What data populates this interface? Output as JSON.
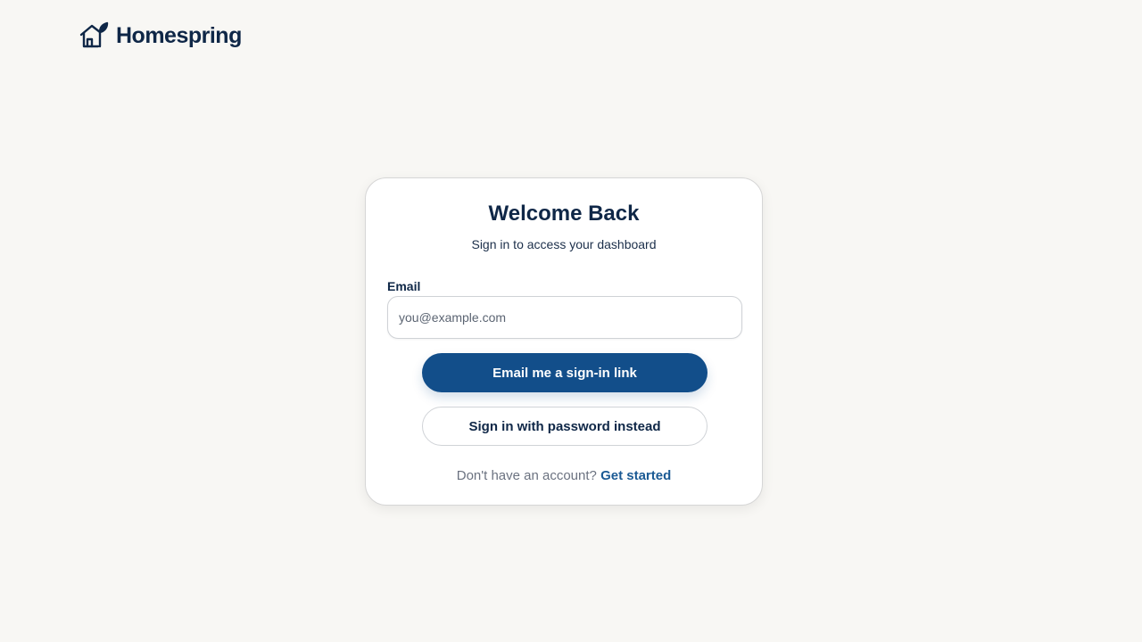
{
  "brand": {
    "name": "Homespring",
    "logo_icon": "house-with-sprout-icon"
  },
  "card": {
    "title": "Welcome Back",
    "subtitle": "Sign in to access your dashboard",
    "email": {
      "label": "Email",
      "placeholder": "you@example.com",
      "value": ""
    },
    "primary_button": "Email me a sign-in link",
    "secondary_button": "Sign in with password instead",
    "footer": {
      "prompt": "Don't have an account?",
      "link": "Get started"
    }
  },
  "colors": {
    "background": "#f8f7f4",
    "primary": "#124e8a",
    "text_dark": "#0f2747",
    "link": "#1b5a94"
  }
}
